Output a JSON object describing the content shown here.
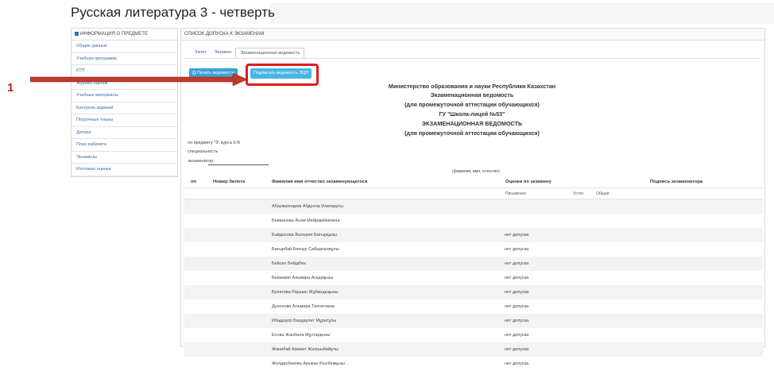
{
  "page_title": "Русская литература 3 - четверть",
  "annotation_number": "1",
  "sidebar": {
    "header": "ИНФОРМАЦИЯ О ПРЕДМЕТЕ",
    "items": [
      "Общие данные",
      "Учебная программа",
      "КТП",
      "Журнал оценок",
      "Учебные материалы",
      "Контроль заданий",
      "Поурочные планы",
      "Детали",
      "План кабинета",
      "Экзамены",
      "Итоговые оценки"
    ]
  },
  "main": {
    "header": "СПИСОК ДОПУСКА К ЭКЗАМЕНАМ",
    "tabs": [
      "Зачет",
      "Экзамен",
      "Экзаменационная ведомость"
    ],
    "print_button": "Печать ведомости",
    "sign_button": "Подписать ведомость ЭЦП"
  },
  "document": {
    "heading_lines": [
      "Министерство образования и науки Республики Казахстан",
      "Экзаменационная ведомость",
      "(для промежуточной аттестации обучающихся)",
      "ГУ \"Школа-лицей №53\"",
      "ЭКЗАМЕНАЦИОННАЯ ВЕДОМОСТЬ",
      "(для промежуточной аттестации обучающихся)"
    ],
    "subject_line": "по предмету \"9\" курса 9-В",
    "specialty_line": "специальность",
    "examiner_label": "экзаменатор",
    "fio_caption": "(фамилия, имя, отчество)"
  },
  "table": {
    "headers": {
      "num": "пп",
      "ticket": "Номер билета",
      "name": "Фамилия имя отчество экзаменующегося",
      "grades": "Оценки по экзамену",
      "sign": "Подпись экзаменатора"
    },
    "subheaders": [
      "Письменно",
      "Устно",
      "Общая"
    ],
    "rows": [
      {
        "name": "Абаужаппаров Абдулла Илкпаруты",
        "status": ""
      },
      {
        "name": "Бекжанова Асем Мейрамбековна",
        "status": ""
      },
      {
        "name": "Байдосова Валерия Батырқызы",
        "status": "нет допуска"
      },
      {
        "name": "Батырбай Бекнур Сабырғалиұлы",
        "status": "нет допуска"
      },
      {
        "name": "Бейсен Бейдібек",
        "status": "нет допуска"
      },
      {
        "name": "Бекжеміп Альмира Асқарқызы",
        "status": "нет допуска"
      },
      {
        "name": "Булатова Раушан Жұбандықызы",
        "status": "нет допуска"
      },
      {
        "name": "Дусенова Альмира Талгатовна",
        "status": "нет допуска"
      },
      {
        "name": "Ибадшуғр Бахдаулет Мұратұлы",
        "status": "нет допуска"
      },
      {
        "name": "Есова Жанбала Мұхтарқызы",
        "status": "нет допуска"
      },
      {
        "name": "Жанибай Азамат Жалшыбайұлы",
        "status": "нет допуска"
      },
      {
        "name": "Жолдасбекова Аружан Рысбекқызы",
        "status": "нет допуска"
      }
    ]
  },
  "colors": {
    "accent": "#3aa3d6",
    "annotation": "#e01b1b",
    "link": "#3a6aa6"
  }
}
